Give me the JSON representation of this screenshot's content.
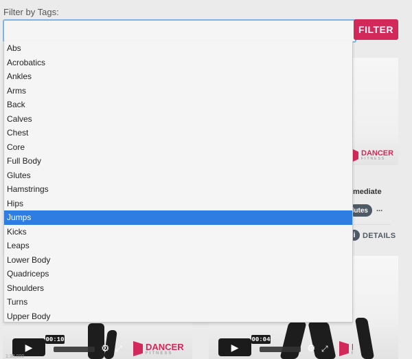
{
  "filter": {
    "label": "Filter by Tags:",
    "input_value": "",
    "button_label": "FILTER"
  },
  "dropdown": {
    "selected": "Jumps",
    "options": [
      "Abs",
      "Acrobatics",
      "Ankles",
      "Arms",
      "Back",
      "Calves",
      "Chest",
      "Core",
      "Full Body",
      "Glutes",
      "Hamstrings",
      "Hips",
      "Jumps",
      "Kicks",
      "Leaps",
      "Lower Body",
      "Quadriceps",
      "Shoulders",
      "Turns",
      "Upper Body"
    ]
  },
  "brand": {
    "name": "DANCER",
    "sub": "FITNESS"
  },
  "card": {
    "level_text": "mediate",
    "tag_text": "lutes",
    "more": "...",
    "details_label": "DETAILS"
  },
  "videos": [
    {
      "time": "00:10",
      "under": "1:30,000"
    },
    {
      "time": "00:04"
    }
  ],
  "colors": {
    "accent": "#d2285a",
    "selection": "#2e7de2",
    "input_focus": "#7fb2e8"
  },
  "icons": [
    "play-icon",
    "gear-icon",
    "fullscreen-icon",
    "info-icon"
  ]
}
